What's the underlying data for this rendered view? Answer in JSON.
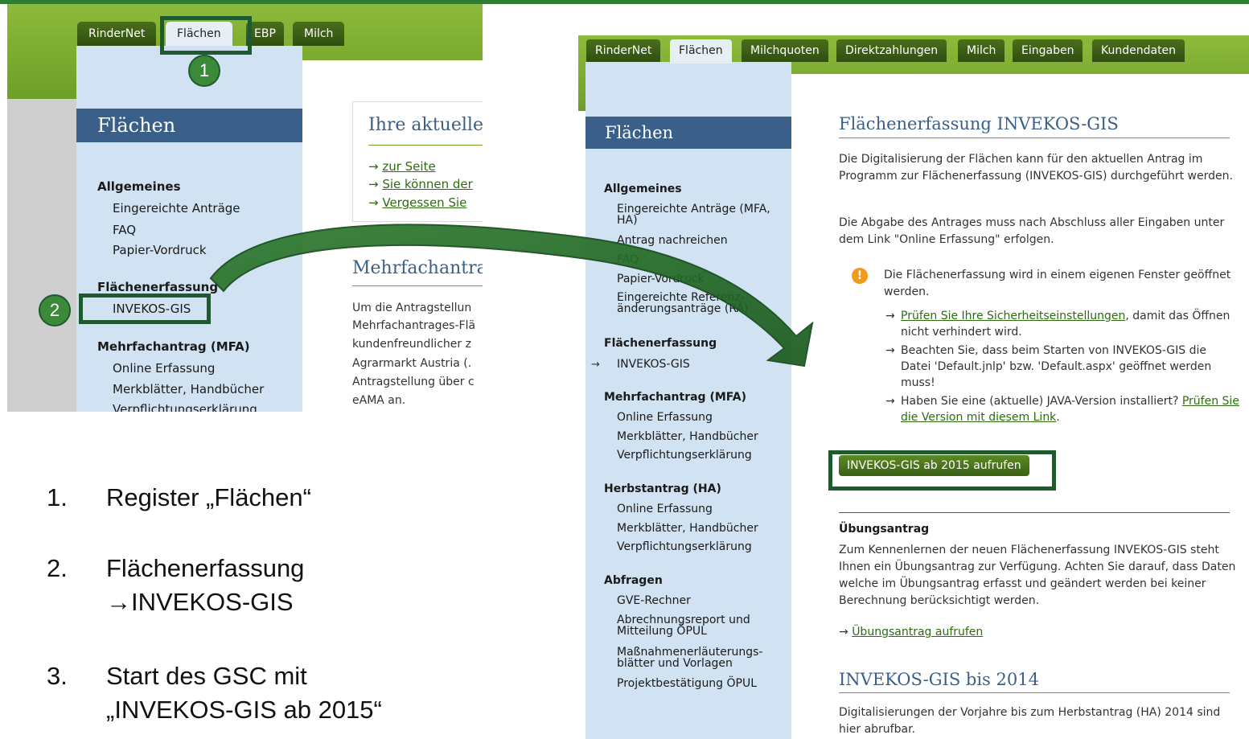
{
  "left_screenshot": {
    "tabs": [
      "RinderNet",
      "Flächen",
      "EBP",
      "Milch"
    ],
    "sidebar_title": "Flächen",
    "sections": [
      {
        "heading": "Allgemeines",
        "items": [
          "Eingereichte Anträge",
          "FAQ",
          "Papier-Vordruck"
        ]
      },
      {
        "heading": "Flächenerfassung",
        "items": [
          "INVEKOS-GIS"
        ]
      },
      {
        "heading": "Mehrfachantrag (MFA)",
        "items": [
          "Online Erfassung",
          "Merkblätter, Handbücher",
          "Verpflichtungserklärung"
        ]
      }
    ],
    "box_title": "Ihre aktuelle",
    "box_links": [
      "zur Seite",
      "Sie können der",
      "Vergessen Sie"
    ],
    "heading2": "Mehrfachantra",
    "paragraph_lines": [
      "Um die Antragstellun",
      "Mehrfachantrages-Flä",
      "kundenfreundlicher z",
      "Agrarmarkt Austria (.",
      "Antragstellung über c",
      "eAMA an."
    ],
    "markers": [
      "1",
      "2"
    ]
  },
  "steps": [
    {
      "number": "1.",
      "lines": [
        "Register „Flächen“"
      ]
    },
    {
      "number": "2.",
      "lines": [
        "Flächenerfassung",
        "→INVEKOS-GIS"
      ]
    },
    {
      "number": "3.",
      "lines": [
        "Start des GSC mit",
        "„INVEKOS-GIS ab 2015“"
      ]
    }
  ],
  "right_screenshot": {
    "tabs": [
      "RinderNet",
      "Flächen",
      "Milchquoten",
      "Direktzahlungen",
      "Milch",
      "Eingaben",
      "Kundendaten"
    ],
    "sidebar_title": "Flächen",
    "allgemeines": {
      "heading": "Allgemeines",
      "items": [
        "Eingereichte Anträge (MFA,",
        "HA)",
        "Antrag nachreichen",
        "FAQ",
        "Papier-Vordruck",
        "Eingereichte Referenz-",
        "änderungsanträge (RÄ)"
      ]
    },
    "flaechenerfassung": {
      "heading": "Flächenerfassung",
      "items": [
        "INVEKOS-GIS"
      ]
    },
    "mfa": {
      "heading": "Mehrfachantrag (MFA)",
      "items": [
        "Online Erfassung",
        "Merkblätter, Handbücher",
        "Verpflichtungserklärung"
      ]
    },
    "ha": {
      "heading": "Herbstantrag (HA)",
      "items": [
        "Online Erfassung",
        "Merkblätter, Handbücher",
        "Verpflichtungserklärung"
      ]
    },
    "abfragen": {
      "heading": "Abfragen",
      "items": [
        "GVE-Rechner",
        "Abrechnungsreport und",
        "Mitteilung ÖPUL",
        "Maßnahmenerläuterungs-",
        "blätter und Vorlagen",
        "Projektbestätigung ÖPUL"
      ]
    },
    "content": {
      "title": "Flächenerfassung INVEKOS-GIS",
      "p1": "Die Digitalisierung der Flächen kann für den aktuellen Antrag im Programm zur Flächenerfassung (INVEKOS-GIS) durchgeführt werden.",
      "p2": "Die Abgabe des Antrages muss nach Abschluss aller Eingaben unter dem Link \"Online Erfassung\" erfolgen.",
      "info": "Die Flächenerfassung wird in einem eigenen Fenster geöffnet werden.",
      "bullet1_link": "Prüfen Sie Ihre Sicherheitseinstellungen",
      "bullet1_rest": ", damit das Öffnen nicht verhindert wird.",
      "bullet2": "Beachten Sie, dass beim Starten von INVEKOS-GIS die Datei 'Default.jnlp' bzw. 'Default.aspx' geöffnet werden muss!",
      "bullet3_text": "Haben Sie eine (aktuelle) JAVA-Version installiert? ",
      "bullet3_link": "Prüfen Sie die Version mit diesem Link",
      "button": "INVEKOS-GIS ab 2015 aufrufen",
      "uebung_heading": "Übungsantrag",
      "uebung_text": "Zum Kennenlernen der neuen Flächenerfassung INVEKOS-GIS steht Ihnen ein Übungsantrag zur Verfügung. Achten Sie darauf, dass Daten welche im Übungsantrag erfasst und geändert werden bei keiner Berechnung berücksichtigt werden.",
      "uebung_link": "Übungsantrag aufrufen",
      "title2": "INVEKOS-GIS bis 2014",
      "p3": "Digitalisierungen der Vorjahre bis zum Herbstantrag (HA) 2014 sind hier abrufbar."
    }
  },
  "colors": {
    "green_tab": "#3b5e17",
    "sidebar_bg": "#d1e2f2",
    "title_blue": "#3a5f88",
    "highlight": "#1e5a2e",
    "info_orange": "#f29a1c"
  }
}
